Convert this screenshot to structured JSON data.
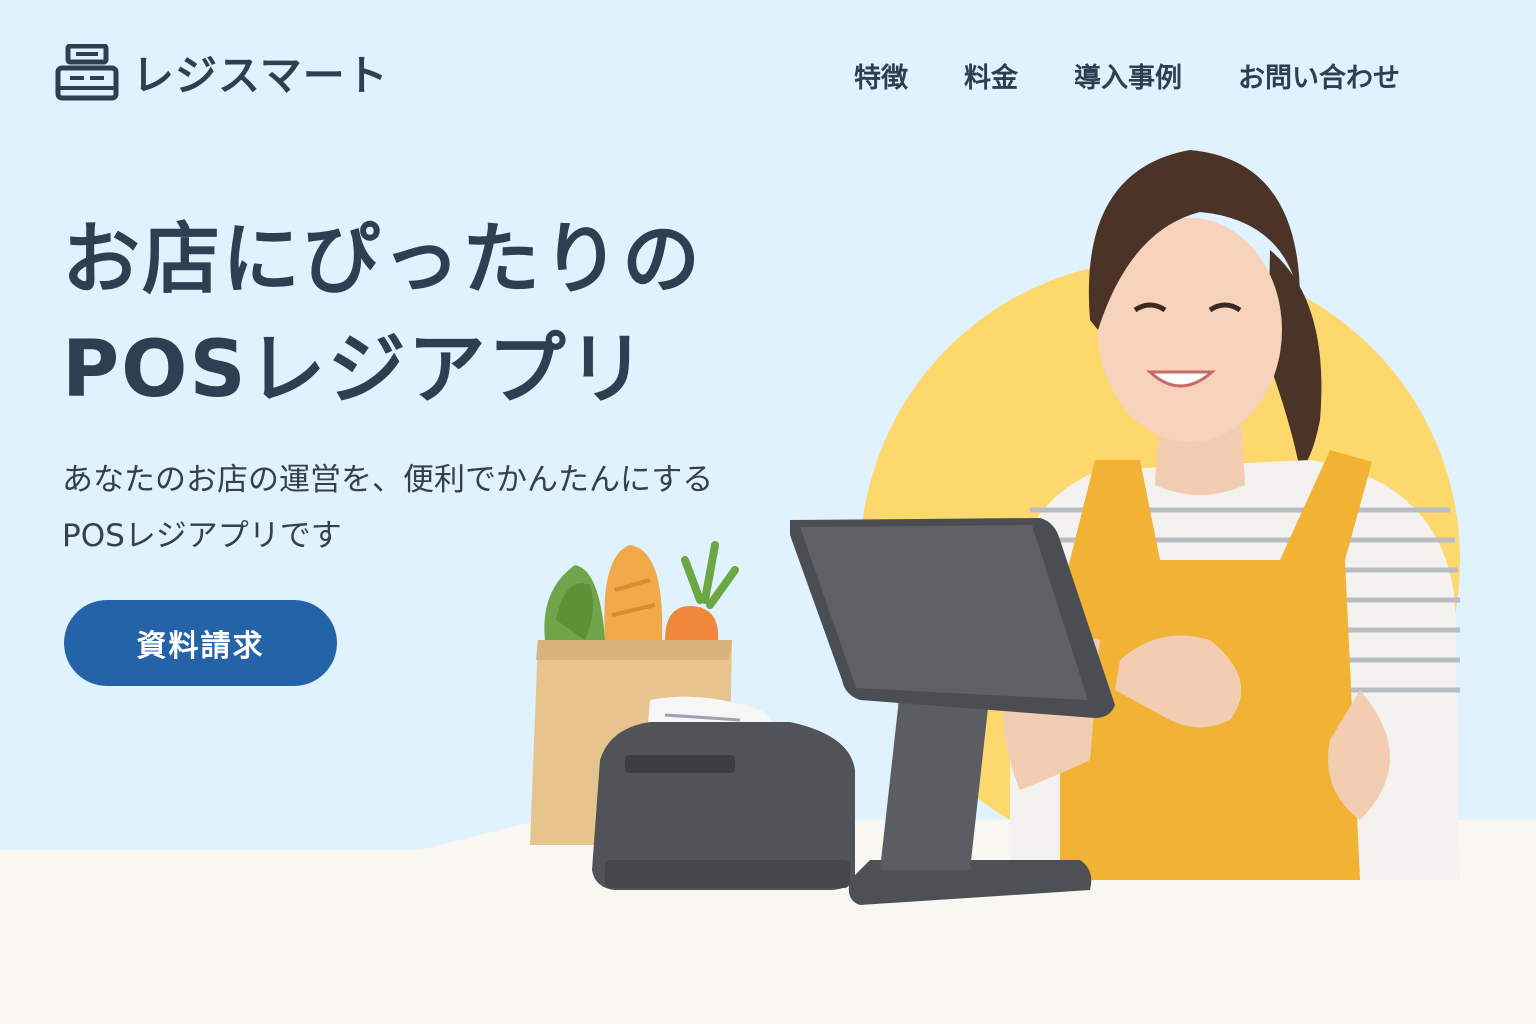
{
  "brand": {
    "name": "レジスマート",
    "logo_icon": "cash-register-icon"
  },
  "nav": {
    "items": [
      {
        "label": "特徴"
      },
      {
        "label": "料金"
      },
      {
        "label": "導入事例"
      },
      {
        "label": "お問い合わせ"
      }
    ]
  },
  "hero": {
    "title_line1": "お店にぴったりの",
    "title_line2": "POSレジアプリ",
    "subtitle_line1": "あなたのお店の運営を、便利でかんたんにする",
    "subtitle_line2": "POSレジアプリです",
    "cta_label": "資料請求"
  },
  "colors": {
    "background": "#dff2fd",
    "text": "#2e3f52",
    "accent_button": "#2563a8",
    "sun_circle": "#fdd86d",
    "apron": "#f2b233"
  }
}
